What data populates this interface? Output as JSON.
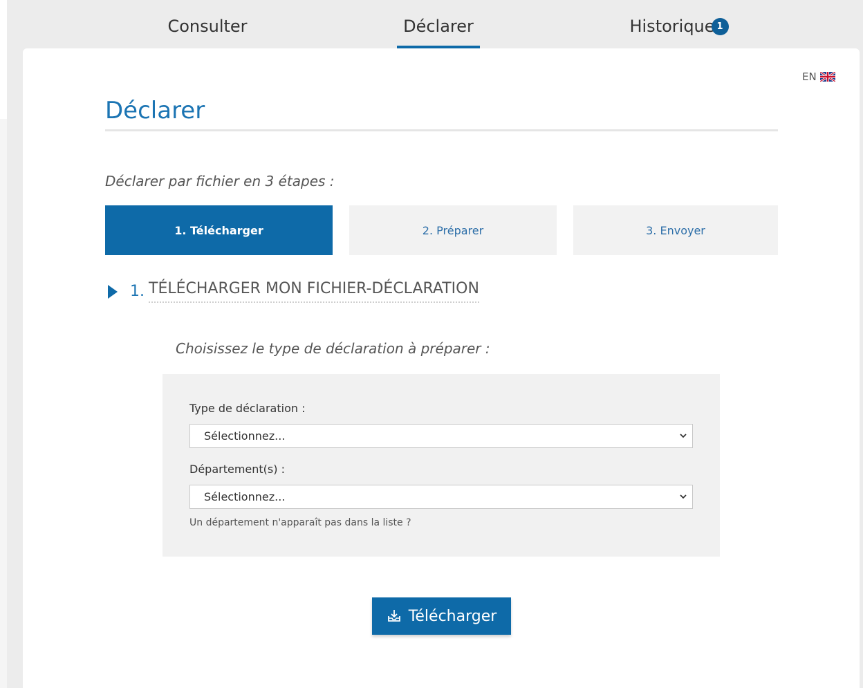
{
  "nav": {
    "tabs": [
      {
        "label": "Consulter"
      },
      {
        "label": "Déclarer"
      },
      {
        "label": "Historique",
        "badge": "1"
      }
    ]
  },
  "lang": {
    "label": "EN"
  },
  "page": {
    "title": "Déclarer",
    "steps_intro": "Déclarer par fichier en 3 étapes :",
    "steps": [
      {
        "label": "1. Télécharger"
      },
      {
        "label": "2. Préparer"
      },
      {
        "label": "3. Envoyer"
      }
    ]
  },
  "section": {
    "number": "1.",
    "label": "TÉLÉCHARGER MON FICHIER-DÉCLARATION",
    "prompt": "Choisissez le type de déclaration à préparer :"
  },
  "form": {
    "type_label": "Type de déclaration :",
    "type_value": "Sélectionnez...",
    "dept_label": "Département(s) :",
    "dept_value": "Sélectionnez...",
    "hint": "Un département n'apparaît pas dans la liste ?"
  },
  "download": {
    "label": "Télécharger"
  },
  "colors": {
    "primary": "#0e6aa8",
    "title": "#1b74b3",
    "panel": "#f1f1f1"
  }
}
